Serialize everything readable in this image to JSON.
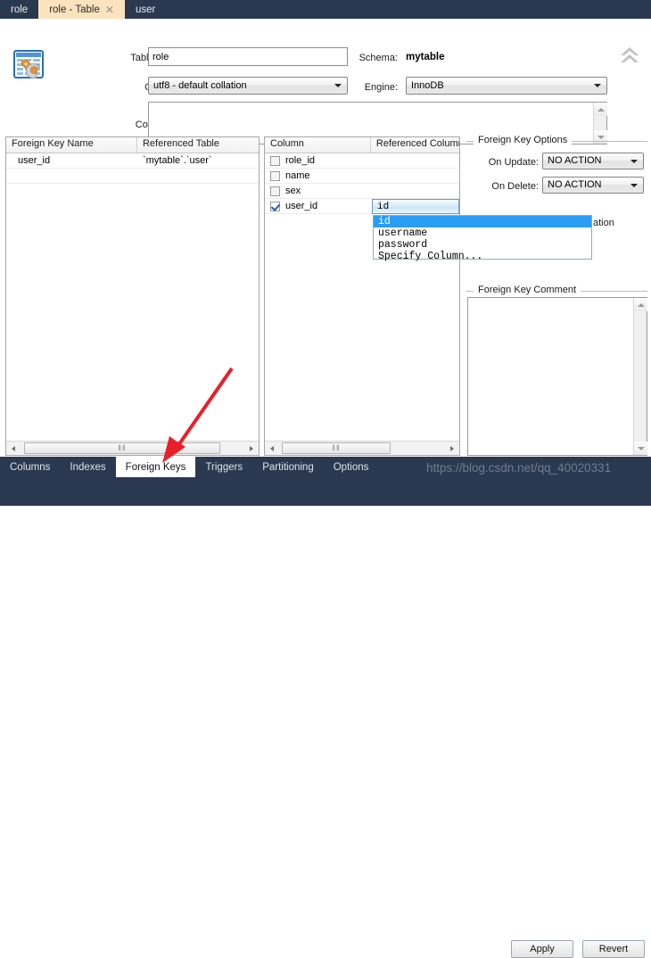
{
  "window": {
    "app": "MySQL Workbench Table Editor",
    "accent_color": "#2b3950",
    "active_tab_color": "#fae3bd"
  },
  "document_tabs": [
    {
      "label": "role",
      "active": false,
      "closable": false
    },
    {
      "label": "role - Table",
      "active": true,
      "closable": true,
      "close_glyph": "✕"
    },
    {
      "label": "user",
      "active": false,
      "closable": false
    }
  ],
  "header": {
    "icon_name": "table-editor-icon",
    "table_name_label": "Table Name:",
    "table_name_value": "role",
    "schema_label": "Schema:",
    "schema_value": "mytable",
    "collation_label": "Collation:",
    "collation_value": "utf8 - default collation",
    "engine_label": "Engine:",
    "engine_value": "InnoDB",
    "comments_label": "Comments:",
    "comments_value": "",
    "collapse_icon": "chevron-double-up-icon"
  },
  "fk_list": {
    "columns": [
      "Foreign Key Name",
      "Referenced Table"
    ],
    "rows": [
      {
        "name": "user_id",
        "referenced_table": "`mytable`.`user`"
      }
    ],
    "scroll_grip": "‖‖"
  },
  "column_list": {
    "columns": [
      "Column",
      "Referenced Column"
    ],
    "rows": [
      {
        "checked": false,
        "column": "role_id",
        "referenced_column": ""
      },
      {
        "checked": false,
        "column": "name",
        "referenced_column": ""
      },
      {
        "checked": false,
        "column": "sex",
        "referenced_column": ""
      },
      {
        "checked": true,
        "column": "user_id",
        "referenced_column": "id"
      }
    ],
    "scroll_grip": "‖‖"
  },
  "referenced_column_editor": {
    "value": "id",
    "open": true,
    "options": [
      "id",
      "username",
      "password",
      "Specify Column..."
    ],
    "selected_index": 0
  },
  "fk_options": {
    "title": "Foreign Key Options",
    "on_update_label": "On Update:",
    "on_update_value": "NO ACTION",
    "on_delete_label": "On Delete:",
    "on_delete_value": "NO ACTION",
    "obscured_option_tail": "ation"
  },
  "fk_comment": {
    "title": "Foreign Key Comment",
    "value": ""
  },
  "bottom_tabs": [
    {
      "label": "Columns",
      "active": false
    },
    {
      "label": "Indexes",
      "active": false
    },
    {
      "label": "Foreign Keys",
      "active": true
    },
    {
      "label": "Triggers",
      "active": false
    },
    {
      "label": "Partitioning",
      "active": false
    },
    {
      "label": "Options",
      "active": false
    }
  ],
  "actions": {
    "apply_label": "Apply",
    "revert_label": "Revert"
  },
  "watermark": {
    "text": "https://blog.csdn.net/qq_40020331"
  },
  "annotation": {
    "arrow_color": "#e8202a",
    "name": "red-pointer-arrow"
  }
}
